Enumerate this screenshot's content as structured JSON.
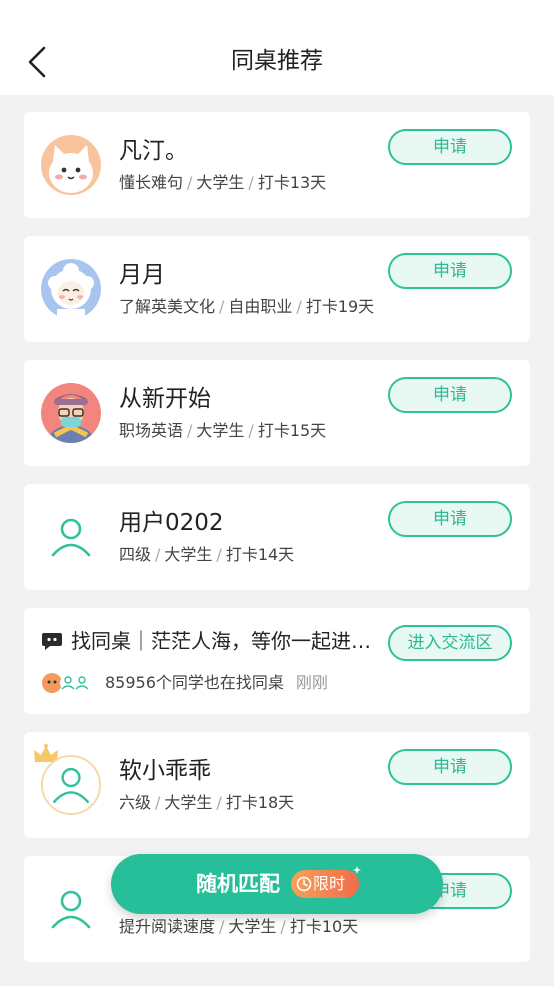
{
  "header": {
    "title": "同桌推荐"
  },
  "cards": [
    {
      "name": "凡汀。",
      "tags": [
        "懂长难句",
        "大学生",
        "打卡13天"
      ],
      "button": "申请"
    },
    {
      "name": "月月",
      "tags": [
        "了解英美文化",
        "自由职业",
        "打卡19天"
      ],
      "button": "申请"
    },
    {
      "name": "从新开始",
      "tags": [
        "职场英语",
        "大学生",
        "打卡15天"
      ],
      "button": "申请"
    },
    {
      "name": "用户0202",
      "tags": [
        "四级",
        "大学生",
        "打卡14天"
      ],
      "button": "申请"
    }
  ],
  "promo": {
    "title": "找同桌｜茫茫人海，等你一起进…",
    "count_text": "85956个同学也在找同桌",
    "time": "刚刚",
    "button": "进入交流区"
  },
  "cards2": [
    {
      "name": "软小乖乖",
      "tags": [
        "六级",
        "大学生",
        "打卡18天"
      ],
      "button": "申请"
    },
    {
      "name": "",
      "tags": [
        "提升阅读速度",
        "大学生",
        "打卡10天"
      ],
      "button": "申请"
    }
  ],
  "match": {
    "label": "随机匹配",
    "badge": "限时"
  },
  "colors": {
    "accent": "#27bf9a",
    "button_border": "#2fc19b",
    "badge": "#f26b4b"
  }
}
